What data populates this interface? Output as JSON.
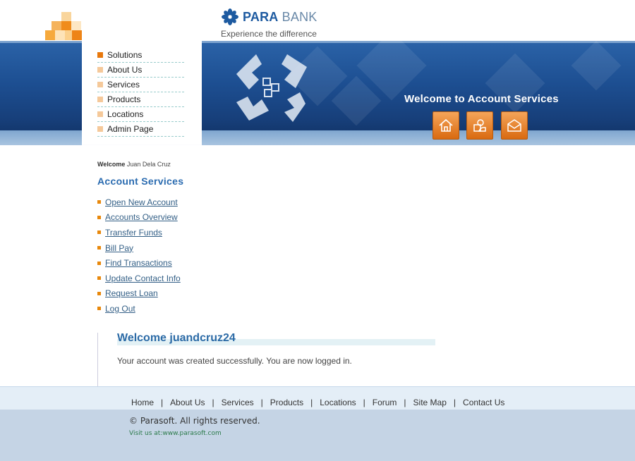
{
  "header": {
    "brand_bold": "PARA",
    "brand_rest": " BANK",
    "tagline": "Experience the difference",
    "banner_title": "Welcome to Account Services",
    "icons": [
      "home-icon",
      "about-icon",
      "contact-icon"
    ]
  },
  "left_menu": {
    "items": [
      "Solutions",
      "About Us",
      "Services",
      "Products",
      "Locations",
      "Admin Page"
    ]
  },
  "account": {
    "welcome_label": "Welcome",
    "user_name": "Juan Dela Cruz",
    "title": "Account Services",
    "links": [
      "Open New Account",
      "Accounts Overview",
      "Transfer Funds",
      "Bill Pay",
      "Find Transactions",
      "Update Contact Info",
      "Request Loan",
      "Log Out"
    ]
  },
  "content": {
    "title": "Welcome juandcruz24",
    "message": "Your account was created successfully. You are now logged in."
  },
  "footer": {
    "links": [
      "Home",
      "About Us",
      "Services",
      "Products",
      "Locations",
      "Forum",
      "Site Map",
      "Contact Us"
    ],
    "separator": "|",
    "copyright": "© Parasoft. All rights reserved.",
    "visit": "Visit us at:www.parasoft.com"
  },
  "colors": {
    "accent_orange": "#e8780c",
    "link_blue": "#335f86",
    "heading_blue": "#2a6bb0",
    "banner_blue": "#1d4f92"
  }
}
